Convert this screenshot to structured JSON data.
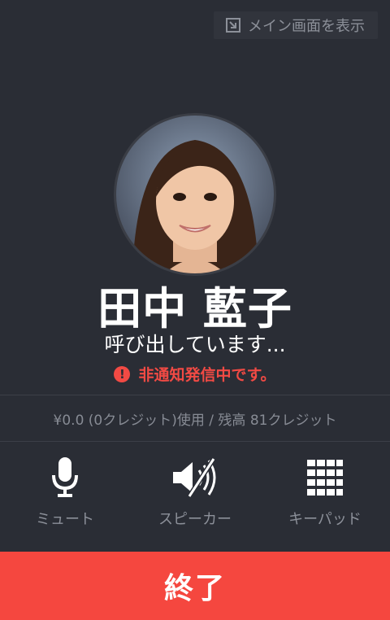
{
  "header": {
    "show_main_label": "メイン画面を表示",
    "icon": "exit-to-main-icon"
  },
  "contact": {
    "name": "田中 藍子",
    "avatar": "contact-photo"
  },
  "call": {
    "status": "呼び出しています...",
    "warning": "非通知発信中です。",
    "warning_icon": "exclamation-icon",
    "credit_info": "¥0.0 (0クレジット)使用 / 残高 81クレジット"
  },
  "controls": [
    {
      "label": "ミュート",
      "icon": "microphone-icon"
    },
    {
      "label": "スピーカー",
      "icon": "speaker-off-icon"
    },
    {
      "label": "キーパッド",
      "icon": "keypad-icon"
    }
  ],
  "end_button": {
    "label": "終了"
  },
  "colors": {
    "background": "#2a2d35",
    "accent": "#f5473f",
    "warning": "#f24a44"
  }
}
